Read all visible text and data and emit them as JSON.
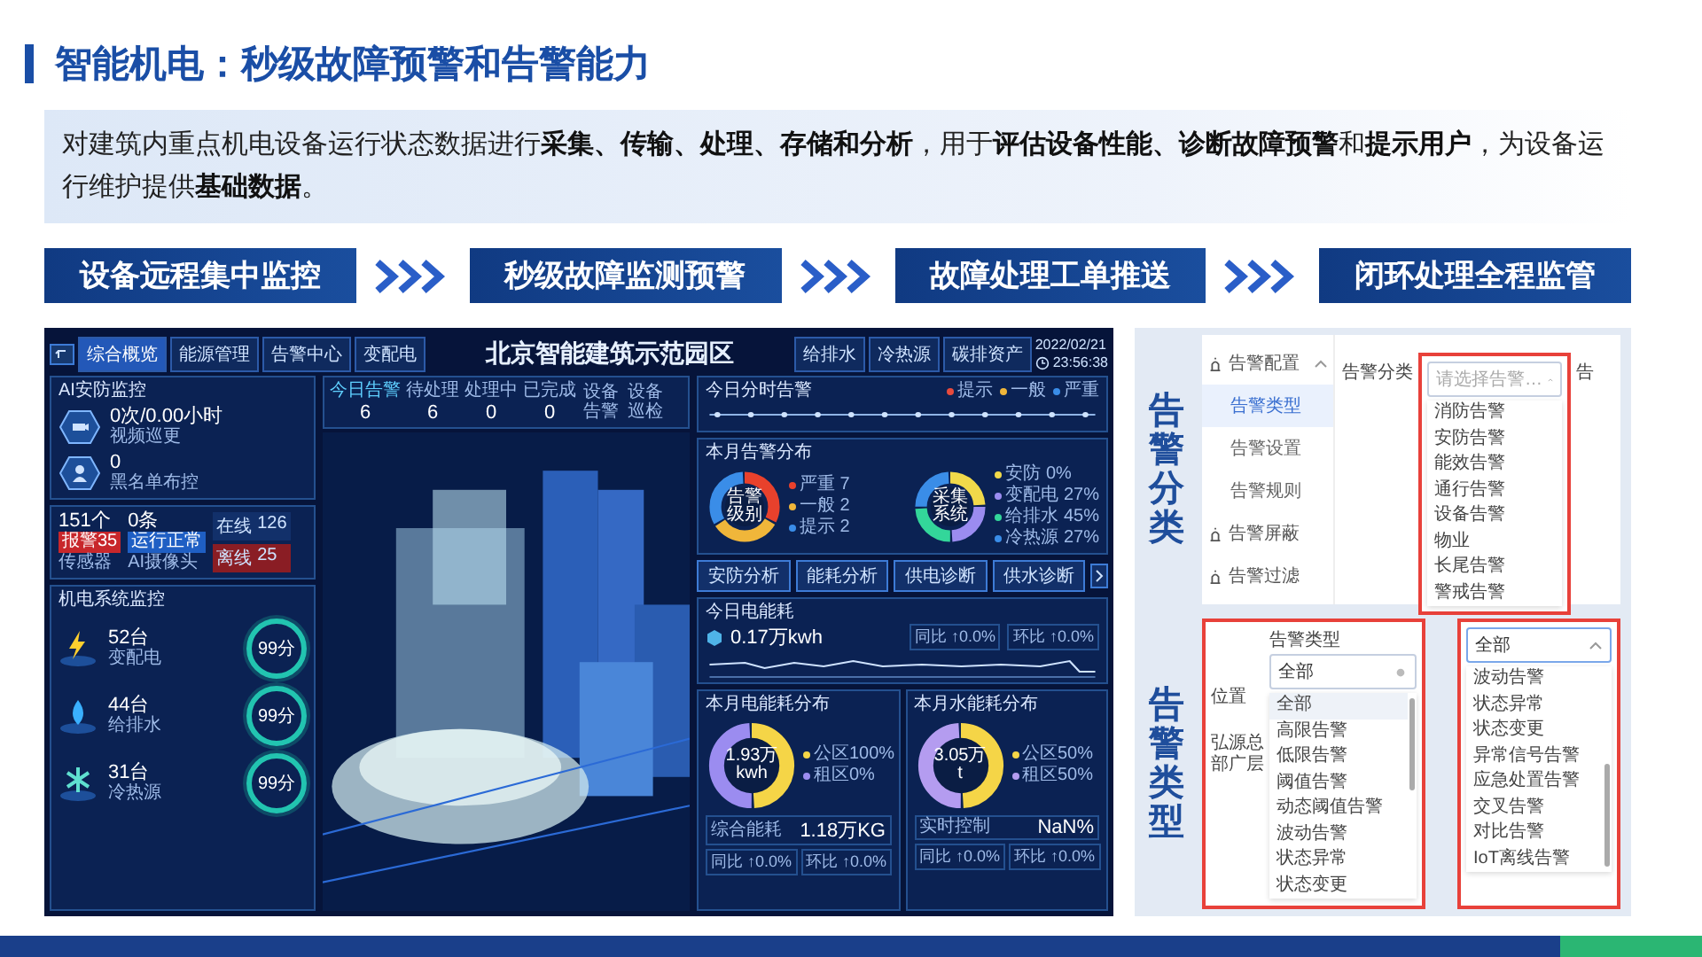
{
  "title": "智能机电：秒级故障预警和告警能力",
  "intro": "对建筑内重点机电设备运行状态数据进行**采集、传输、处理、存储和分析**，用于**评估设备性能、诊断故障预警**和**提示用户**，为设备运行维护提供**基础数据**。",
  "steps": [
    "设备远程集中监控",
    "秒级故障监测预警",
    "故障处理工单推送",
    "闭环处理全程监管"
  ],
  "dashboard": {
    "tabs_left": [
      {
        "label": "综合概览",
        "selected": true
      },
      {
        "label": "能源管理",
        "selected": false
      },
      {
        "label": "告警中心",
        "selected": false
      },
      {
        "label": "变配电",
        "selected": false
      }
    ],
    "title": "北京智能建筑示范园区",
    "tabs_right": [
      {
        "label": "给排水",
        "selected": false
      },
      {
        "label": "冷热源",
        "selected": false
      },
      {
        "label": "碳排资产",
        "selected": false
      }
    ],
    "date": "2022/02/21",
    "time": "23:56:38",
    "security": {
      "title": "AI安防监控",
      "stats": [
        {
          "value": "0次/0.00小时",
          "label": "视频巡更",
          "kind": "camera"
        },
        {
          "value": "0",
          "label": "黑名单布控",
          "kind": "person"
        }
      ]
    },
    "devices": {
      "items": [
        {
          "value": "151个",
          "badge": "报警35",
          "label": "传感器",
          "kind": "alarm"
        },
        {
          "value": "0条",
          "badge": "运行正常",
          "label": "AI摄像头",
          "kind": "normal"
        }
      ],
      "status": [
        {
          "label": "在线",
          "value": "126",
          "kind": "online"
        },
        {
          "label": "离线",
          "value": "25",
          "kind": "offline"
        }
      ]
    },
    "systems": {
      "title": "机电系统监控",
      "rows": [
        {
          "count": "52台",
          "name": "变配电",
          "score": "99分",
          "kind": "power"
        },
        {
          "count": "44台",
          "name": "给排水",
          "score": "99分",
          "kind": "water"
        },
        {
          "count": "31台",
          "name": "冷热源",
          "score": "99分",
          "kind": "hvac"
        }
      ]
    },
    "alarms": {
      "title": "今日告警",
      "count": "6",
      "stats": [
        {
          "label": "待处理",
          "value": "6"
        },
        {
          "label": "处理中",
          "value": "0"
        },
        {
          "label": "已完成",
          "value": "0"
        }
      ],
      "links": [
        "设备告警",
        "设备巡检"
      ]
    },
    "hourly": {
      "title": "今日分时告警",
      "legend": [
        {
          "label": "提示",
          "color": "#e84a3c"
        },
        {
          "label": "一般",
          "color": "#f0b63a"
        },
        {
          "label": "严重",
          "color": "#3a8de8"
        }
      ]
    },
    "distribution": {
      "title": "本月告警分布",
      "groups": [
        {
          "center": "告警级别",
          "legend": [
            {
              "label": "严重 7",
              "color": "#e8412c"
            },
            {
              "label": "一般 2",
              "color": "#f0b63a"
            },
            {
              "label": "提示 2",
              "color": "#3a8de8"
            }
          ]
        },
        {
          "center": "采集系统",
          "legend": [
            {
              "label": "安防 0%",
              "color": "#f1d94a"
            },
            {
              "label": "变配电 27%",
              "color": "#9b8cf0"
            },
            {
              "label": "给排水 45%",
              "color": "#33d69a"
            },
            {
              "label": "冷热源 27%",
              "color": "#3a8de8"
            }
          ]
        }
      ]
    },
    "buttons": [
      "安防分析",
      "能耗分析",
      "供电诊断",
      "供水诊断"
    ],
    "energy_today": {
      "title": "今日电能耗",
      "value": "0.17万kwh",
      "compare": [
        "同比 ↑0.0%",
        "环比 ↑0.0%"
      ]
    },
    "month_panels": [
      {
        "title": "本月电能耗分布",
        "center": "1.93万kwh",
        "legend": [
          {
            "label": "公区100%",
            "color": "#f5d547"
          },
          {
            "label": "租区0%",
            "color": "#9b8cf0"
          }
        ],
        "metric": "综合能耗",
        "metric_value": "1.18万KG",
        "compare": [
          "同比 ↑0.0%",
          "环比 ↑0.0%"
        ]
      },
      {
        "title": "本月水能耗分布",
        "center": "3.05万t",
        "legend": [
          {
            "label": "公区50%",
            "color": "#f5d547"
          },
          {
            "label": "租区50%",
            "color": "#b49cf0"
          }
        ],
        "metric": "实时控制",
        "metric_value": "NaN%",
        "compare": [
          "同比 ↑0.0%",
          "环比 ↑0.0%"
        ]
      }
    ]
  },
  "categories": {
    "label": "告警分类",
    "menu": [
      {
        "label": "告警配置",
        "children": [
          {
            "label": "告警类型",
            "selected": true
          },
          {
            "label": "告警设置",
            "selected": false
          },
          {
            "label": "告警规则",
            "selected": false
          }
        ]
      },
      {
        "label": "告警屏蔽"
      },
      {
        "label": "告警过滤"
      }
    ],
    "field_label": "告警分类",
    "placeholder": "请选择告警…",
    "next_label": "告",
    "options": [
      "消防告警",
      "安防告警",
      "能效告警",
      "通行告警",
      "设备告警",
      "物业",
      "长尾告警",
      "警戒告警"
    ]
  },
  "types": {
    "label": "告警类型",
    "left": {
      "field_label": "告警类型",
      "value": "全部",
      "cells": [
        "位置",
        "弘源总部广层"
      ],
      "options": [
        {
          "label": "全部",
          "selected": true
        },
        {
          "label": "高限告警",
          "selected": false
        },
        {
          "label": "低限告警",
          "selected": false
        },
        {
          "label": "阈值告警",
          "selected": false
        },
        {
          "label": "动态阈值告警",
          "selected": false
        },
        {
          "label": "波动告警",
          "selected": false
        },
        {
          "label": "状态异常",
          "selected": false
        },
        {
          "label": "状态变更",
          "selected": false
        }
      ]
    },
    "right": {
      "value": "全部",
      "options": [
        "波动告警",
        "状态异常",
        "状态变更",
        "异常信号告警",
        "应急处置告警",
        "交叉告警",
        "对比告警",
        "IoT离线告警"
      ]
    }
  }
}
